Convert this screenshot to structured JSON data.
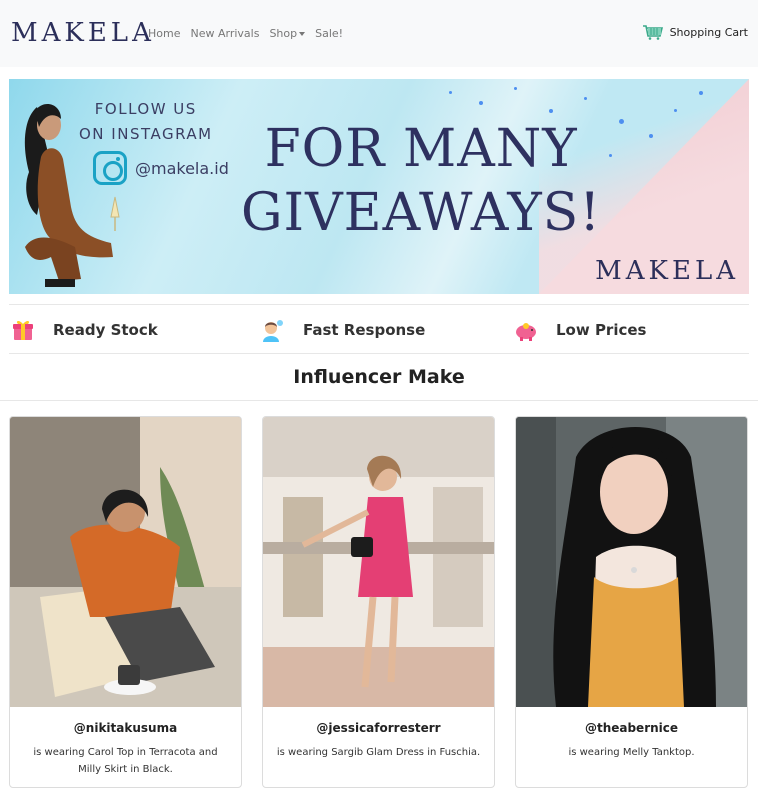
{
  "navbar": {
    "brand": "MAKELA",
    "links": [
      "Home",
      "New Arrivals",
      "Shop",
      "Sale!"
    ],
    "cart_label": "Shopping Cart"
  },
  "banner": {
    "follow_line1": "FOLLOW US",
    "follow_line2": "ON INSTAGRAM",
    "instagram_handle": "@makela.id",
    "headline_line1": "FOR MANY",
    "headline_line2": "GIVEAWAYS!",
    "brand": "MAKELA"
  },
  "features": [
    {
      "label": "Ready Stock",
      "icon": "gift-icon"
    },
    {
      "label": "Fast Response",
      "icon": "support-agent-icon"
    },
    {
      "label": "Low Prices",
      "icon": "piggy-bank-icon"
    }
  ],
  "section_title": "Influencer Make",
  "cards": [
    {
      "handle": "@nikitakusuma",
      "description": "is wearing Carol Top in Terracota and Milly Skirt in Black."
    },
    {
      "handle": "@jessicaforresterr",
      "description": "is wearing Sargib Glam Dress in Fuschia."
    },
    {
      "handle": "@theabernice",
      "description": "is wearing Melly Tanktop."
    }
  ],
  "colors": {
    "brand_navy": "#2c2f5a",
    "instagram_teal": "#1aa2c5",
    "cart_green": "#3aa98a"
  }
}
